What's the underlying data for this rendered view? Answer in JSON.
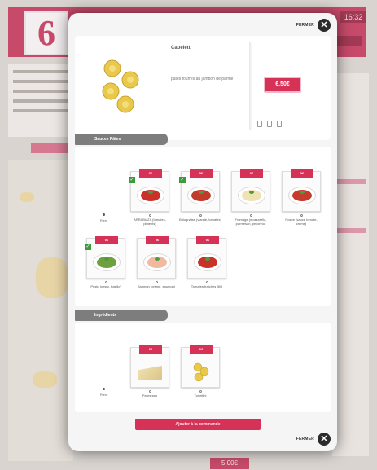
{
  "background": {
    "clock": "16:32",
    "bottom_price": "5.00€"
  },
  "modal": {
    "close_label": "FERMER",
    "close_symbol": "✕",
    "product": {
      "name": "Capeletti",
      "description": "pâtes fourrés au jambon de parme",
      "price": "6.50€"
    },
    "sections": {
      "sauces": {
        "title": "Sauces Pâtes",
        "none_label": "Rien",
        "items": [
          {
            "label": "ARRABIATA (tomates, piments)",
            "price": "0€",
            "selected": true,
            "sauce_color": "#c9312a"
          },
          {
            "label": "Bolognaise (viande, tomates)",
            "price": "0€",
            "selected": true,
            "sauce_color": "#c13a2c"
          },
          {
            "label": "Fromage (mozzarella, parmesan, pecorino)",
            "price": "0€",
            "selected": false,
            "sauce_color": "#efe3b4"
          },
          {
            "label": "Rosée (sauce tomate, crème)",
            "price": "0€",
            "selected": false,
            "sauce_color": "#c73a2e"
          },
          {
            "label": "Pesto (pesto, basilic)",
            "price": "0€",
            "selected": true,
            "sauce_color": "#6fa03f"
          },
          {
            "label": "Saumon (crème, saumon)",
            "price": "0€",
            "selected": false,
            "sauce_color": "#f2b8a0"
          },
          {
            "label": "Tomates fraîches BIO",
            "price": "0€",
            "selected": false,
            "sauce_color": "#c7332b"
          }
        ]
      },
      "ingredients": {
        "title": "Ingrédients",
        "none_label": "Rien",
        "items": [
          {
            "label": "Parmesan",
            "price": "0€",
            "kind": "cheese"
          },
          {
            "label": "Tortellini",
            "price": "0€",
            "kind": "pasta"
          }
        ]
      }
    },
    "add_button_label": "Ajouter à la commande"
  },
  "colors": {
    "accent": "#d63156",
    "background_header": "#c74a6a",
    "section_tab": "#7d7d7d"
  }
}
